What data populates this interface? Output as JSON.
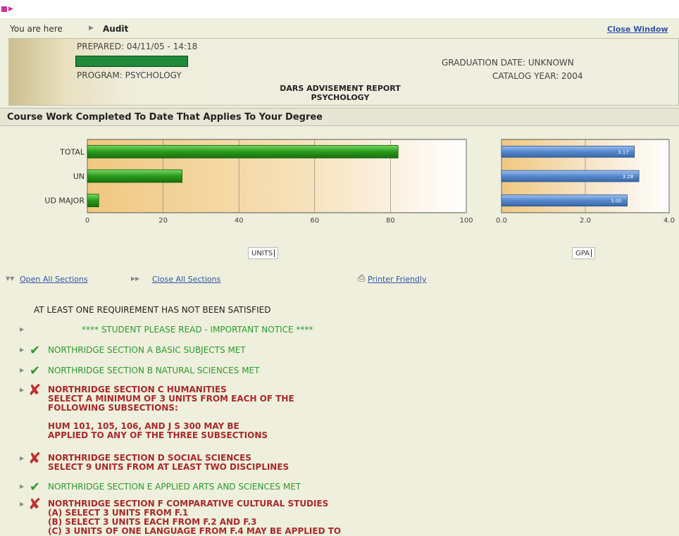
{
  "breadcrumb": {
    "prefix": "You are here",
    "current": "Audit",
    "close_window": "Close Window"
  },
  "header": {
    "prepared": "PREPARED: 04/11/05 - 14:18",
    "program": "PROGRAM: PSYCHOLOGY",
    "graduation_date": "GRADUATION DATE: UNKNOWN",
    "catalog_year": "CATALOG YEAR: 2004",
    "report_title": "DARS ADVISEMENT REPORT",
    "report_subtitle": "PSYCHOLOGY"
  },
  "section_title": "Course Work Completed To Date That Applies To Your Degree",
  "chart_data": [
    {
      "type": "bar",
      "orientation": "horizontal",
      "categories": [
        "TOTAL",
        "UN",
        "UD MAJOR"
      ],
      "values": [
        82,
        25,
        3
      ],
      "xlabel": "UNITS",
      "xlim": [
        0,
        100
      ],
      "xticks": [
        0,
        20,
        40,
        60,
        80,
        100
      ],
      "grid": true,
      "bar_color": "#2a9a1a"
    },
    {
      "type": "bar",
      "orientation": "horizontal",
      "categories": [
        "TOTAL",
        "UN",
        "UD MAJOR"
      ],
      "values": [
        3.17,
        3.28,
        3.0
      ],
      "data_labels": [
        "3.17",
        "3.28",
        "3.00"
      ],
      "xlabel": "GPA",
      "xlim": [
        0,
        4
      ],
      "xticks": [
        "0.0",
        "2.0",
        "4.0"
      ],
      "grid": true,
      "bar_color": "#5588cc"
    }
  ],
  "controls": {
    "open_all": "Open All Sections",
    "close_all": "Close All Sections",
    "printer": "Printer Friendly"
  },
  "status": "AT LEAST ONE REQUIREMENT HAS NOT BEEN SATISFIED",
  "notice": "**** STUDENT PLEASE READ - IMPORTANT NOTICE ****",
  "requirements": [
    {
      "status": "met",
      "lines": [
        "NORTHRIDGE SECTION A BASIC SUBJECTS MET"
      ]
    },
    {
      "status": "met",
      "lines": [
        "NORTHRIDGE SECTION B NATURAL SCIENCES MET"
      ]
    },
    {
      "status": "not-met",
      "lines": [
        "NORTHRIDGE SECTION C HUMANITIES",
        "SELECT A MINIMUM OF 3 UNITS FROM EACH OF THE",
        "FOLLOWING SUBSECTIONS:",
        "",
        "HUM 101, 105, 106, AND J S 300 MAY BE",
        "APPLIED TO ANY OF THE THREE SUBSECTIONS"
      ]
    },
    {
      "status": "not-met",
      "lines": [
        "NORTHRIDGE SECTION D SOCIAL SCIENCES",
        "SELECT 9 UNITS FROM AT LEAST TWO DISCIPLINES"
      ]
    },
    {
      "status": "met",
      "lines": [
        "NORTHRIDGE SECTION E APPLIED ARTS AND SCIENCES MET"
      ]
    },
    {
      "status": "not-met",
      "lines": [
        "NORTHRIDGE SECTION F COMPARATIVE CULTURAL STUDIES",
        "(A) SELECT 3 UNITS FROM F.1",
        "(B) SELECT 3 UNITS EACH FROM F.2 AND F.3",
        "(C) 3 UNITS OF ONE LANGUAGE FROM F.4 MAY BE APPLIED TO"
      ]
    }
  ],
  "colors": {
    "met": "#2e9a2e",
    "not_met": "#a82a2a",
    "link": "#3355aa"
  }
}
